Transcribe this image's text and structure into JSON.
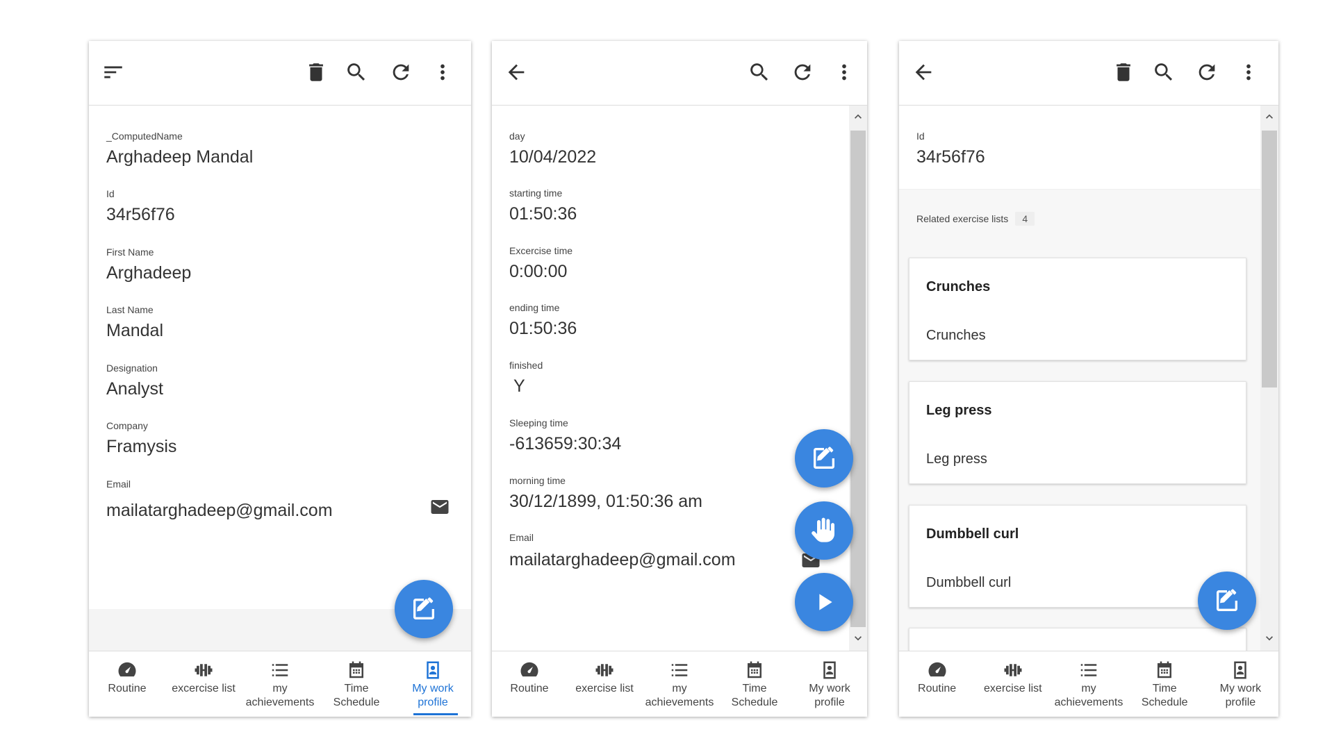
{
  "panel1": {
    "fields": [
      {
        "label": "_ComputedName",
        "value": "Arghadeep Mandal"
      },
      {
        "label": "Id",
        "value": "34r56f76"
      },
      {
        "label": "First Name",
        "value": "Arghadeep"
      },
      {
        "label": "Last Name",
        "value": "Mandal"
      },
      {
        "label": "Designation",
        "value": "Analyst"
      },
      {
        "label": "Company",
        "value": "Framysis"
      },
      {
        "label": "Email",
        "value": "mailatarghadeep@gmail.com"
      }
    ]
  },
  "panel2": {
    "fields": [
      {
        "label": "day",
        "value": "10/04/2022"
      },
      {
        "label": "starting time",
        "value": "01:50:36"
      },
      {
        "label": "Excercise time",
        "value": "0:00:00"
      },
      {
        "label": "ending time",
        "value": "01:50:36"
      },
      {
        "label": "finished",
        "value": "Y"
      },
      {
        "label": "Sleeping time",
        "value": "-613659:30:34"
      },
      {
        "label": "morning time",
        "value": "30/12/1899, 01:50:36 am"
      },
      {
        "label": "Email",
        "value": "mailatarghadeep@gmail.com"
      }
    ]
  },
  "panel3": {
    "id_label": "Id",
    "id_value": "34r56f76",
    "related_label": "Related exercise lists",
    "related_count": "4",
    "cards": [
      {
        "title": "Crunches",
        "subtitle": "Crunches"
      },
      {
        "title": "Leg press",
        "subtitle": "Leg press"
      },
      {
        "title": "Dumbbell curl",
        "subtitle": "Dumbbell curl"
      }
    ]
  },
  "nav_a": {
    "routine": "Routine",
    "exercise": "excercise list",
    "achievements_1": "my",
    "achievements_2": "achievements",
    "schedule_1": "Time",
    "schedule_2": "Schedule",
    "profile_1": "My work",
    "profile_2": "profile"
  },
  "nav_b": {
    "routine": "Routine",
    "exercise": "exercise list",
    "achievements_1": "my",
    "achievements_2": "achievements",
    "schedule_1": "Time",
    "schedule_2": "Schedule",
    "profile_1": "My work",
    "profile_2": "profile"
  },
  "colors": {
    "accent": "#1e73d6",
    "fab": "#3a86e0"
  },
  "icons": [
    "sort-menu-icon",
    "delete-icon",
    "search-icon",
    "refresh-icon",
    "more-vert-icon",
    "back-arrow-icon",
    "mail-icon",
    "edit-icon",
    "hand-icon",
    "play-icon",
    "dashboard-icon",
    "dumbbell-icon",
    "list-icon",
    "calendar-icon",
    "badge-icon"
  ]
}
